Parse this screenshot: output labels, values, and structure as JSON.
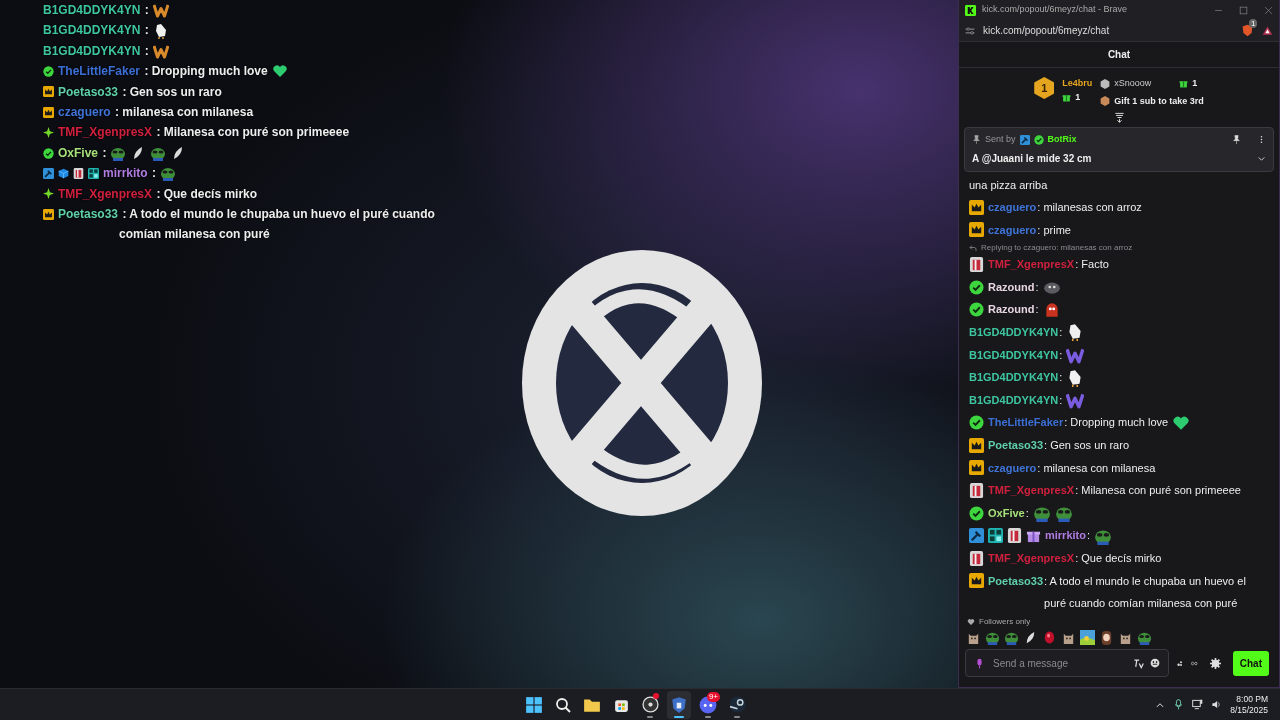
{
  "overlay_chat": {
    "messages": [
      {
        "user": "B1GD4DDYK4YN",
        "color": "#3ec6a0",
        "text": " :",
        "emotes": [
          {
            "kind": "w",
            "color": "#d98b2b"
          }
        ]
      },
      {
        "user": "B1GD4DDYK4YN",
        "color": "#3ec6a0",
        "text": " :",
        "emotes": [
          {
            "kind": "hand"
          }
        ]
      },
      {
        "user": "B1GD4DDYK4YN",
        "color": "#3ec6a0",
        "text": " :",
        "emotes": [
          {
            "kind": "w",
            "color": "#d98b2b"
          }
        ]
      },
      {
        "badges": [
          {
            "kind": "verified"
          }
        ],
        "user": "TheLittleFaker",
        "color": "#3c6fd6",
        "text": " : Dropping much love",
        "emotes": [
          {
            "kind": "heart"
          }
        ]
      },
      {
        "badges": [
          {
            "kind": "crown"
          }
        ],
        "user": "Poetaso33",
        "color": "#5fd0a8",
        "text": " : Gen sos un raro"
      },
      {
        "badges": [
          {
            "kind": "crown"
          }
        ],
        "user": "czaguero",
        "color": "#3f74d8",
        "text": " : milanesa con milanesa"
      },
      {
        "badges": [
          {
            "kind": "sparkle"
          }
        ],
        "user": "TMF_XgenpresX",
        "color": "#d0203e",
        "text": " : Milanesa con puré son primeeee"
      },
      {
        "badges": [
          {
            "kind": "verified"
          }
        ],
        "user": "OxFive",
        "color": "#a6e07a",
        "text": " :",
        "emotes": [
          {
            "kind": "frog"
          },
          {
            "kind": "feather"
          },
          {
            "kind": "frog"
          },
          {
            "kind": "feather"
          }
        ]
      },
      {
        "badges": [
          {
            "kind": "hammer"
          },
          {
            "kind": "cube"
          },
          {
            "kind": "cup"
          },
          {
            "kind": "tile"
          }
        ],
        "user": "mirrkito",
        "color": "#b07ce0",
        "text": " :",
        "emotes": [
          {
            "kind": "frog"
          }
        ]
      },
      {
        "badges": [
          {
            "kind": "sparkle"
          }
        ],
        "user": "TMF_XgenpresX",
        "color": "#d0203e",
        "text": " : Que decís mirko"
      },
      {
        "badges": [
          {
            "kind": "crown"
          }
        ],
        "user": "Poetaso33",
        "color": "#5fd0a8",
        "text": " : A todo el mundo le chupaba un huevo el puré cuando comían milanesa con puré"
      }
    ]
  },
  "browser": {
    "title": "kick.com/popout/6meyz/chat - Brave",
    "address": "kick.com/popout/6meyz/chat",
    "shield_count": "1"
  },
  "chat": {
    "header": "Chat",
    "leaderboard": [
      {
        "rank": "1",
        "user": "Le4bru",
        "count": "1"
      },
      {
        "user": "xSnooow",
        "count": "1"
      },
      {
        "text": "Gift 1 sub to take 3rd"
      }
    ],
    "pinned": {
      "sent_by": "Sent by",
      "author": "BotRix",
      "text": "A @Juaani le mide 32 cm"
    },
    "messages": [
      {
        "text": "una pizza arriba"
      },
      {
        "badges": [
          {
            "kind": "crown"
          }
        ],
        "user": "czaguero",
        "color": "#3f74d8",
        "text": ": milanesas con arroz"
      },
      {
        "badges": [
          {
            "kind": "crown"
          }
        ],
        "user": "czaguero",
        "color": "#3f74d8",
        "text": ": prime"
      },
      {
        "reply": "Replying to czaguero: milanesas con arroz",
        "badges": [
          {
            "kind": "cup"
          }
        ],
        "user": "TMF_XgenpresX",
        "color": "#d0203e",
        "text": ": Facto"
      },
      {
        "badges": [
          {
            "kind": "verified"
          }
        ],
        "user": "Razound",
        "color": "#e8d6e0",
        "text": ":",
        "emotes": [
          {
            "kind": "blob"
          }
        ]
      },
      {
        "badges": [
          {
            "kind": "verified"
          }
        ],
        "user": "Razound",
        "color": "#e8d6e0",
        "text": ":",
        "emotes": [
          {
            "kind": "ghost"
          }
        ]
      },
      {
        "user": "B1GD4DDYK4YN",
        "color": "#3ec6a0",
        "text": ":",
        "emotes": [
          {
            "kind": "hand"
          }
        ]
      },
      {
        "user": "B1GD4DDYK4YN",
        "color": "#3ec6a0",
        "text": ":",
        "emotes": [
          {
            "kind": "w",
            "color": "#7a5ce0"
          }
        ]
      },
      {
        "user": "B1GD4DDYK4YN",
        "color": "#3ec6a0",
        "text": ":",
        "emotes": [
          {
            "kind": "hand"
          }
        ]
      },
      {
        "user": "B1GD4DDYK4YN",
        "color": "#3ec6a0",
        "text": ":",
        "emotes": [
          {
            "kind": "w",
            "color": "#7a5ce0"
          }
        ]
      },
      {
        "badges": [
          {
            "kind": "verified"
          }
        ],
        "user": "TheLittleFaker",
        "color": "#3c6fd6",
        "text": ": Dropping much love",
        "emotes": [
          {
            "kind": "heart"
          }
        ]
      },
      {
        "badges": [
          {
            "kind": "crown"
          }
        ],
        "user": "Poetaso33",
        "color": "#5fd0a8",
        "text": ": Gen sos un raro"
      },
      {
        "badges": [
          {
            "kind": "crown"
          }
        ],
        "user": "czaguero",
        "color": "#3f74d8",
        "text": ": milanesa con milanesa"
      },
      {
        "badges": [
          {
            "kind": "cup"
          }
        ],
        "user": "TMF_XgenpresX",
        "color": "#d0203e",
        "text": ": Milanesa con puré son primeeee"
      },
      {
        "badges": [
          {
            "kind": "verified"
          }
        ],
        "user": "OxFive",
        "color": "#a6e07a",
        "text": ":",
        "emotes": [
          {
            "kind": "frog"
          },
          {
            "kind": "frog"
          }
        ]
      },
      {
        "badges": [
          {
            "kind": "hammer"
          },
          {
            "kind": "tile"
          },
          {
            "kind": "cup"
          },
          {
            "kind": "gift"
          }
        ],
        "user": "mirrkito",
        "color": "#b07ce0",
        "text": ":",
        "emotes": [
          {
            "kind": "frog"
          }
        ]
      },
      {
        "badges": [
          {
            "kind": "cup"
          }
        ],
        "user": "TMF_XgenpresX",
        "color": "#d0203e",
        "text": ": Que decís mirko"
      },
      {
        "badges": [
          {
            "kind": "crown"
          }
        ],
        "user": "Poetaso33",
        "color": "#5fd0a8",
        "text": ": A todo el mundo le chupaba un huevo el puré cuando comían milanesa con puré"
      }
    ],
    "mode": "Followers only",
    "quick_emotes": [
      {
        "kind": "cat"
      },
      {
        "kind": "frog"
      },
      {
        "kind": "frog"
      },
      {
        "kind": "feather"
      },
      {
        "kind": "gem"
      },
      {
        "kind": "cat"
      },
      {
        "kind": "landscape"
      },
      {
        "kind": "person"
      },
      {
        "kind": "cat"
      },
      {
        "kind": "frog"
      }
    ],
    "input": {
      "placeholder": "Send a message"
    },
    "send_button": "Chat"
  },
  "taskbar": {
    "apps": [
      {
        "kind": "start",
        "selected": false,
        "running": false,
        "alert": false
      },
      {
        "kind": "search",
        "selected": false,
        "running": false,
        "alert": false
      },
      {
        "kind": "folder",
        "selected": false,
        "running": false,
        "alert": false
      },
      {
        "kind": "store",
        "selected": false,
        "running": false,
        "alert": false
      },
      {
        "kind": "recorder",
        "selected": false,
        "running": true,
        "alert": true
      },
      {
        "kind": "shield",
        "selected": true,
        "running": true,
        "alert": false
      },
      {
        "kind": "chat",
        "selected": false,
        "running": true,
        "alert": false,
        "badge": "9+"
      },
      {
        "kind": "steam",
        "selected": false,
        "running": true,
        "alert": false
      }
    ],
    "clock": {
      "time": "8:00 PM",
      "date": "8/15/2025"
    }
  }
}
